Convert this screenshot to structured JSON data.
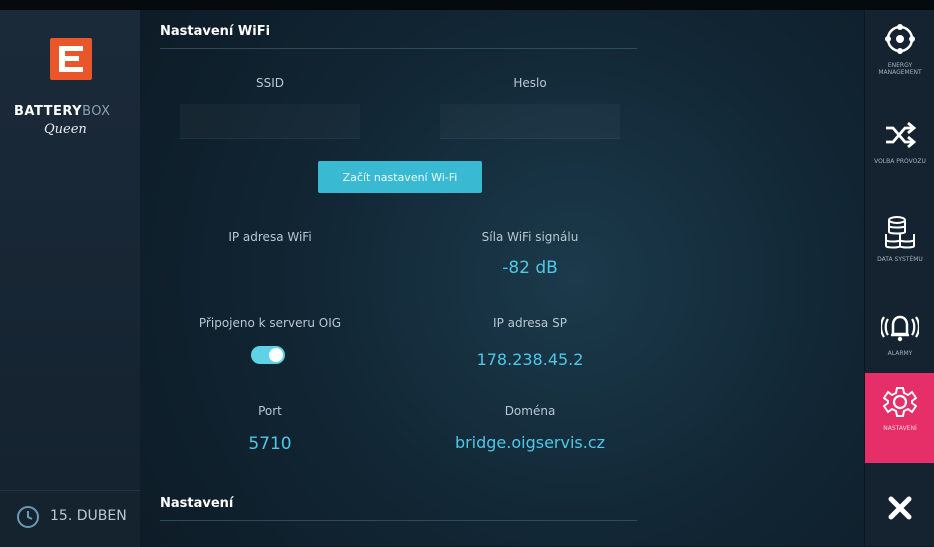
{
  "brand": {
    "name_bold": "BATTERY",
    "name_light": "BOX",
    "subtitle": "Queen"
  },
  "clock": {
    "date": "15. DUBEN"
  },
  "wifi": {
    "section_title": "Nastavení WiFi",
    "ssid_label": "SSID",
    "password_label": "Heslo",
    "button_label": "Začít nastavení Wi-Fi",
    "ip_label": "IP adresa WiFi",
    "signal_label": "Síla WiFi signálu",
    "signal_value": "-82 dB",
    "connected_label": "Připojeno k serveru OIG",
    "connected_state": true,
    "ip_sp_label": "IP adresa SP",
    "ip_sp_value": "178.238.45.2",
    "port_label": "Port",
    "port_value": "5710",
    "domain_label": "Doména",
    "domain_value": "bridge.oigservis.cz"
  },
  "settings": {
    "section_title": "Nastavení"
  },
  "nav": [
    {
      "label": "ENERGY MANAGEMENT",
      "icon": "energy-icon"
    },
    {
      "label": "VOLBA PROVOZU",
      "icon": "shuffle-icon"
    },
    {
      "label": "DATA SYSTÉMU",
      "icon": "database-icon"
    },
    {
      "label": "ALARMY",
      "icon": "bell-icon"
    },
    {
      "label": "NASTAVENÍ",
      "icon": "gear-icon",
      "active": true
    }
  ],
  "colors": {
    "accent": "#3ab9d3",
    "active_nav": "#e62e68",
    "logo": "#e8562a",
    "value": "#4fc7e6"
  }
}
